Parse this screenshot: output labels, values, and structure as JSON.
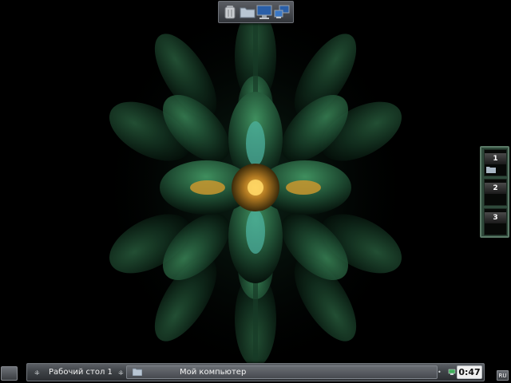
{
  "desktop": {
    "wallpaper": {
      "subject": "green fractal flower",
      "colors": {
        "background": "#000000",
        "petal": "#1f4d33",
        "petal_highlight": "#3f8f5e",
        "core": "#d8a236",
        "core_accent": "#5fc0b0"
      }
    }
  },
  "dock": {
    "items": [
      {
        "icon": "trash-can-icon"
      },
      {
        "icon": "folder-icon"
      },
      {
        "icon": "monitor-icon"
      },
      {
        "icon": "network-computers-icon"
      }
    ]
  },
  "pager": {
    "desktops": [
      {
        "number": "1",
        "has_window": true
      },
      {
        "number": "2",
        "has_window": false
      },
      {
        "number": "3",
        "has_window": false
      }
    ],
    "colors": {
      "frame": "#2f4a3b",
      "border": "#5b7a67"
    }
  },
  "taskbar": {
    "desktop_label": "Рабочий стол 1",
    "task_label": "Мой компьютер",
    "clock": "0:47",
    "language": "RU"
  }
}
